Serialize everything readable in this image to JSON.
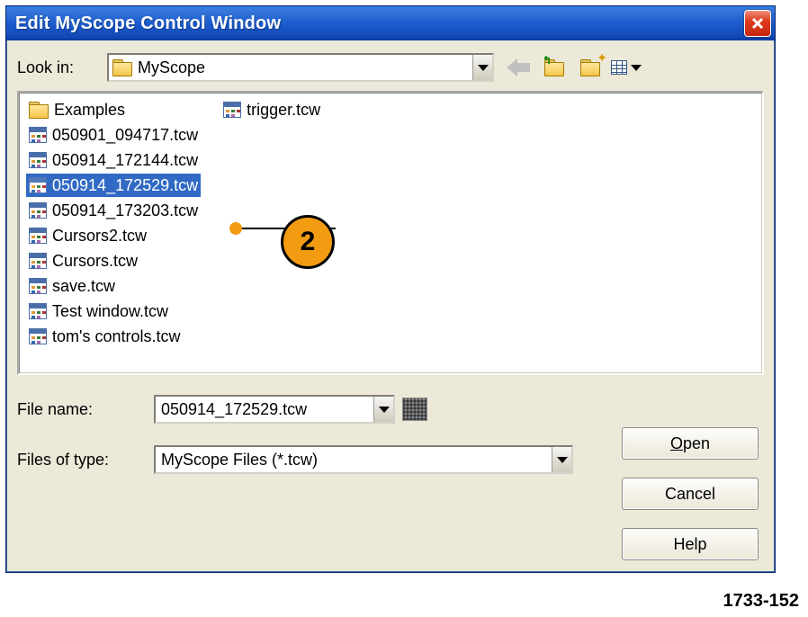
{
  "title": "Edit MyScope Control Window",
  "look_in": {
    "label": "Look in:",
    "value": "MyScope"
  },
  "files_col1": [
    {
      "type": "folder",
      "name": "Examples",
      "selected": false
    },
    {
      "type": "file",
      "name": "050901_094717.tcw",
      "selected": false
    },
    {
      "type": "file",
      "name": "050914_172144.tcw",
      "selected": false
    },
    {
      "type": "file",
      "name": "050914_172529.tcw",
      "selected": true
    },
    {
      "type": "file",
      "name": "050914_173203.tcw",
      "selected": false
    },
    {
      "type": "file",
      "name": "Cursors2.tcw",
      "selected": false
    },
    {
      "type": "file",
      "name": "Cursors.tcw",
      "selected": false
    },
    {
      "type": "file",
      "name": "save.tcw",
      "selected": false
    }
  ],
  "files_col2": [
    {
      "type": "file",
      "name": "Test window.tcw"
    },
    {
      "type": "file",
      "name": "tom's controls.tcw"
    },
    {
      "type": "file",
      "name": "trigger.tcw"
    }
  ],
  "file_name": {
    "label": "File name:",
    "value": "050914_172529.tcw"
  },
  "files_of_type": {
    "label": "Files of type:",
    "value": "MyScope Files (*.tcw)"
  },
  "buttons": {
    "open": "Open",
    "cancel": "Cancel",
    "help": "Help"
  },
  "annotation": {
    "badge": "2"
  },
  "figure_id": "1733-152"
}
